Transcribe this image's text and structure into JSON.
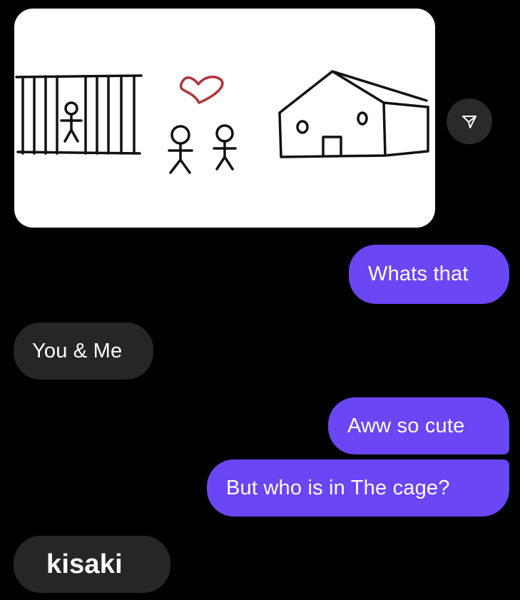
{
  "conversation": {
    "image_message": {
      "description_icon": "drawing-image",
      "heart_color": "#b0333a"
    },
    "share_icon": "send-icon",
    "messages": [
      {
        "side": "sent",
        "text": "Whats that"
      },
      {
        "side": "received",
        "text": "You & Me"
      },
      {
        "side": "sent",
        "text": "Aww so cute"
      },
      {
        "side": "sent",
        "text": "But who is in The cage?"
      },
      {
        "side": "received",
        "text": "kisaki"
      }
    ]
  },
  "colors": {
    "background": "#000000",
    "sent_bubble": "#6b46f5",
    "received_bubble": "#262626",
    "text": "#ffffff"
  }
}
